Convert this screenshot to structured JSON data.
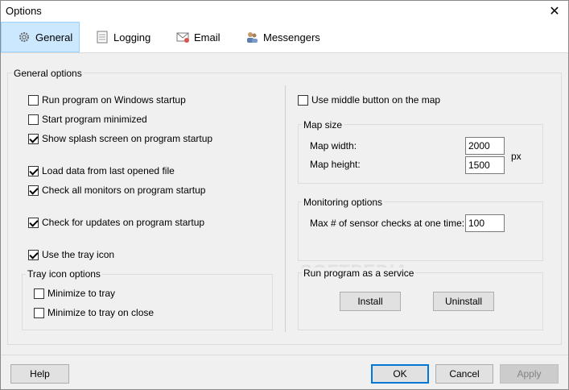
{
  "window": {
    "title": "Options"
  },
  "tabs": [
    {
      "label": "General",
      "icon": "gear-icon"
    },
    {
      "label": "Logging",
      "icon": "document-icon"
    },
    {
      "label": "Email",
      "icon": "envelope-icon"
    },
    {
      "label": "Messengers",
      "icon": "people-icon"
    }
  ],
  "general": {
    "group_label": "General options",
    "run_on_startup": "Run program on Windows startup",
    "start_minimized": "Start program minimized",
    "show_splash": "Show splash screen on program startup",
    "load_last_file": "Load data from last opened file",
    "check_monitors": "Check all monitors on program startup",
    "check_updates": "Check for updates on program startup",
    "use_tray_icon": "Use the tray icon",
    "tray_group_label": "Tray icon options",
    "minimize_to_tray": "Minimize to tray",
    "minimize_to_tray_on_close": "Minimize to tray on close"
  },
  "right": {
    "middle_button": "Use middle button on the map",
    "map_size_label": "Map size",
    "map_width_label": "Map width:",
    "map_width_value": "2000",
    "map_height_label": "Map height:",
    "map_height_value": "1500",
    "px_label": "px",
    "monitoring_label": "Monitoring options",
    "max_checks_label": "Max # of sensor checks at one time:",
    "max_checks_value": "100",
    "service_label": "Run program as a service",
    "install_label": "Install",
    "uninstall_label": "Uninstall"
  },
  "footer": {
    "help": "Help",
    "ok": "OK",
    "cancel": "Cancel",
    "apply": "Apply"
  },
  "watermark": "SOFTPEDIA"
}
